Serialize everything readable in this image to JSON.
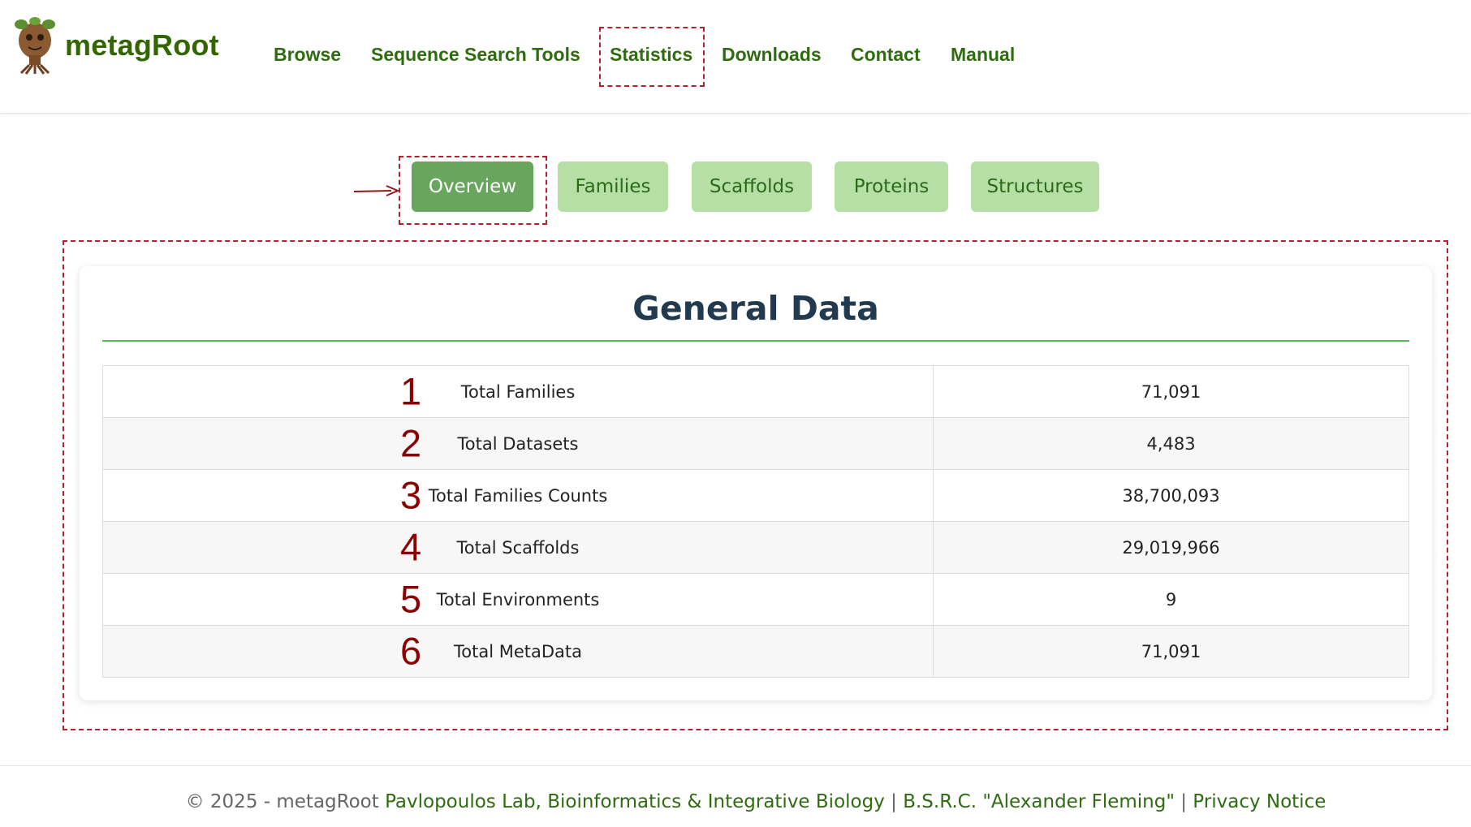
{
  "header": {
    "brand": "metagRoot",
    "logo_icon": "tree-mascot-icon",
    "nav": [
      {
        "label": "Browse"
      },
      {
        "label": "Sequence Search Tools"
      },
      {
        "label": "Statistics"
      },
      {
        "label": "Downloads"
      },
      {
        "label": "Contact"
      },
      {
        "label": "Manual"
      }
    ],
    "active_nav": "Statistics"
  },
  "tabs": [
    {
      "label": "Overview",
      "active": true
    },
    {
      "label": "Families",
      "active": false
    },
    {
      "label": "Scaffolds",
      "active": false
    },
    {
      "label": "Proteins",
      "active": false
    },
    {
      "label": "Structures",
      "active": false
    }
  ],
  "card": {
    "title": "General Data",
    "rows": [
      {
        "num": "1",
        "label": "Total Families",
        "value": "71,091"
      },
      {
        "num": "2",
        "label": "Total Datasets",
        "value": "4,483"
      },
      {
        "num": "3",
        "label": "Total Families Counts",
        "value": "38,700,093"
      },
      {
        "num": "4",
        "label": "Total Scaffolds",
        "value": "29,019,966"
      },
      {
        "num": "5",
        "label": "Total Environments",
        "value": "9"
      },
      {
        "num": "6",
        "label": "Total MetaData",
        "value": "71,091"
      }
    ]
  },
  "footer": {
    "prefix": "© 2025 - metagRoot",
    "lab_link": "Pavlopoulos Lab, Bioinformatics & Integrative Biology",
    "sep1": "|",
    "institute_link": "B.S.R.C. \"Alexander Fleming\"",
    "sep2": "|",
    "privacy_link": "Privacy Notice"
  },
  "colors": {
    "brand_green": "#336600",
    "nav_green": "#2f6b0f",
    "tab_active": "#68a55d",
    "tab_inactive": "#b6dfa6",
    "annotation_red": "#b3232f",
    "number_red": "#8b0000",
    "title_navy": "#223a4f"
  }
}
